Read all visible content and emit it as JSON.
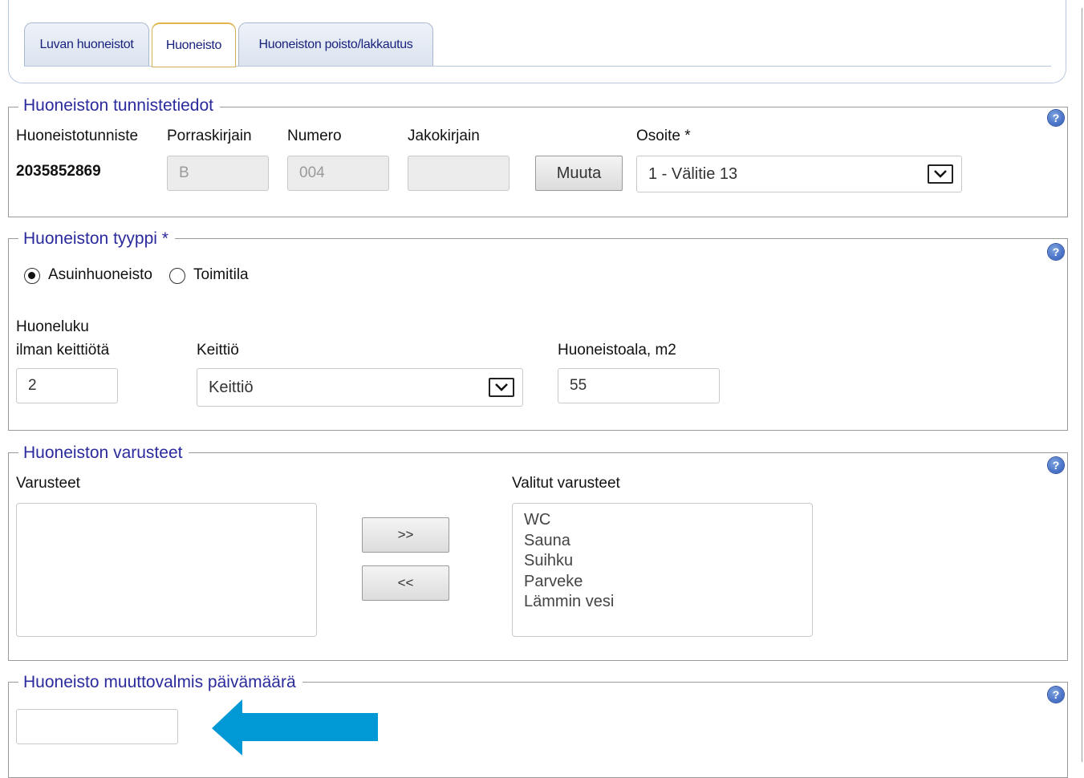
{
  "tabs": [
    {
      "label": "Luvan huoneistot",
      "active": false
    },
    {
      "label": "Huoneisto",
      "active": true
    },
    {
      "label": "Huoneiston poisto/lakkautus",
      "active": false
    }
  ],
  "help_symbol": "?",
  "identification": {
    "legend": "Huoneiston tunnistetiedot",
    "id_label": "Huoneistotunniste",
    "id_value": "2035852869",
    "stair_label": "Porraskirjain",
    "stair_value": "B",
    "number_label": "Numero",
    "number_value": "004",
    "division_label": "Jakokirjain",
    "division_value": "",
    "change_button": "Muuta",
    "address_label": "Osoite *",
    "address_value": "1 - Välitie 13"
  },
  "type": {
    "legend": "Huoneiston tyyppi",
    "required_mark": "*",
    "options": [
      {
        "label": "Asuinhuoneisto",
        "checked": true
      },
      {
        "label": "Toimitila",
        "checked": false
      }
    ],
    "rooms_label_line1": "Huoneluku",
    "rooms_label_line2": "ilman keittiötä",
    "rooms_value": "2",
    "kitchen_label": "Keittiö",
    "kitchen_value": "Keittiö",
    "area_label": "Huoneistoala, m2",
    "area_value": "55"
  },
  "equipment": {
    "legend": "Huoneiston varusteet",
    "available_label": "Varusteet",
    "available_items": [],
    "add_button": ">>",
    "remove_button": "<<",
    "selected_label": "Valitut varusteet",
    "selected_items": [
      "WC",
      "Sauna",
      "Suihku",
      "Parveke",
      "Lämmin vesi"
    ]
  },
  "ready_date": {
    "legend": "Huoneisto muuttovalmis päivämäärä",
    "value": ""
  },
  "colors": {
    "legend": "#2a2a9c",
    "tab_text": "#1a237e",
    "arrow": "#0099d6"
  }
}
